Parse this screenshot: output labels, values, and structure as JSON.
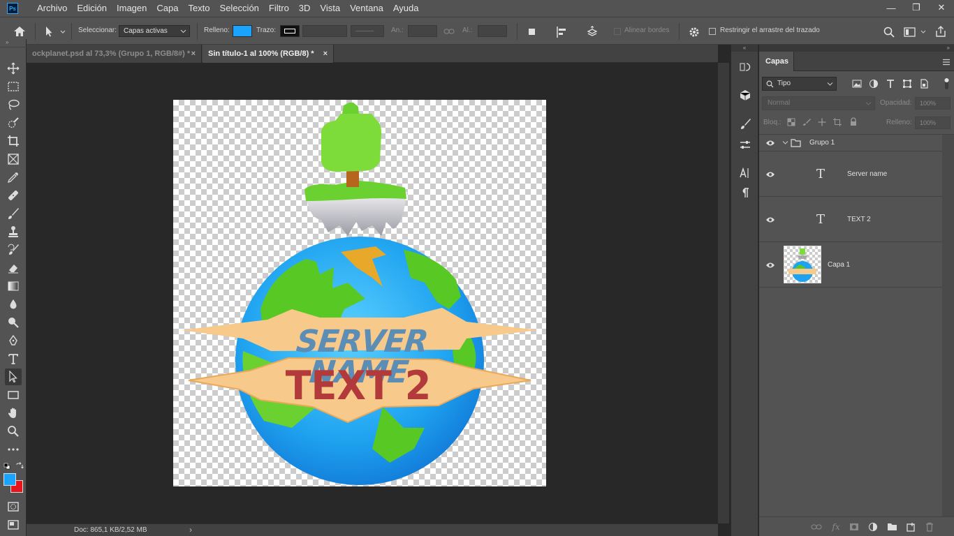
{
  "app": {
    "logo": "Ps"
  },
  "menu": [
    "Archivo",
    "Edición",
    "Imagen",
    "Capa",
    "Texto",
    "Selección",
    "Filtro",
    "3D",
    "Vista",
    "Ventana",
    "Ayuda"
  ],
  "window_controls": {
    "minimize": "—",
    "restore": "❐",
    "close": "✕"
  },
  "options": {
    "select_label": "Seleccionar:",
    "select_value": "Capas activas",
    "fill_label": "Relleno:",
    "fill_color": "#1aa3ff",
    "stroke_label": "Trazo:",
    "width_label": "An.:",
    "height_label": "Al.:",
    "align_edges": "Alinear bordes",
    "constrain_path": "Restringir el arrastre del trazado"
  },
  "tabs": [
    {
      "label": "ockplanet.psd al 73,3% (Grupo 1, RGB/8#) *",
      "close": "×",
      "active": false
    },
    {
      "label": "Sin título-1 al 100% (RGB/8) *",
      "close": "×",
      "active": true
    }
  ],
  "status": {
    "doc": "Doc: 865,1 KB/2,52 MB",
    "arrow": "›"
  },
  "canvas_art": {
    "server_text": "SERVER NAME",
    "text2": "TEXT 2",
    "colors": {
      "server": "#5b8db5",
      "text2": "#b23a3a",
      "banner": "#f7c98a",
      "ocean": "#1fa3f0",
      "land": "#58c924"
    }
  },
  "colors": {
    "foreground": "#1aa3ff",
    "background": "#e8141c"
  },
  "panel": {
    "title": "Capas",
    "filter_label": "Tipo",
    "blend_mode": "Normal",
    "opacity_label": "Opacidad:",
    "opacity_value": "100%",
    "lock_label": "Bloq.:",
    "fill_label": "Relleno:",
    "fill_value": "100%",
    "layers": [
      {
        "name": "Grupo 1",
        "kind": "group"
      },
      {
        "name": "Server name",
        "kind": "text",
        "glyph": "T"
      },
      {
        "name": "TEXT 2",
        "kind": "text",
        "glyph": "T"
      },
      {
        "name": "Capa 1",
        "kind": "pixel"
      }
    ]
  }
}
